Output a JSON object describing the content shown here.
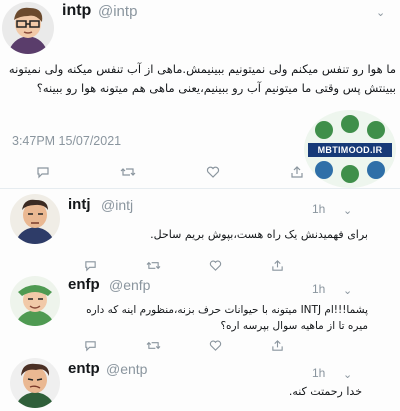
{
  "tweet_main": {
    "name": "intp",
    "handle": "@intp",
    "text": "ما هوا رو تنفس میکنم ولی نمیتونیم ببینیمش.ماهی از آب تنفس میکنه ولی نمیتونه ببینتش پس وقتی ما میتونیم آب رو ببینیم،یعنی ماهی هم میتونه هوا رو ببینه؟",
    "timestamp": "3:47PM 15/07/2021"
  },
  "watermark": {
    "text": "MBTIMOOD.IR"
  },
  "replies": [
    {
      "name": "intj",
      "handle": "@intj",
      "age": "1h",
      "text": "برای فهمیدنش یک راه هست،بپوش بریم ساحل."
    },
    {
      "name": "enfp",
      "handle": "@enfp",
      "age": "1h",
      "text": "پشما!!!ام INTJ میتونه با حیوانات حرف بزنه،منظورم اینه که داره میره تا از ماهیه سوال بپرسه اره؟"
    },
    {
      "name": "entp",
      "handle": "@entp",
      "age": "1h",
      "text": "خدا رحمتت کنه."
    }
  ],
  "icons": {
    "reply": "reply-icon",
    "retweet": "retweet-icon",
    "like": "heart-icon",
    "share": "share-icon",
    "menu": "chevron-down-icon"
  },
  "colors": {
    "muted": "#8a959e",
    "divider": "#e6ecf0",
    "banner": "#173a78"
  }
}
